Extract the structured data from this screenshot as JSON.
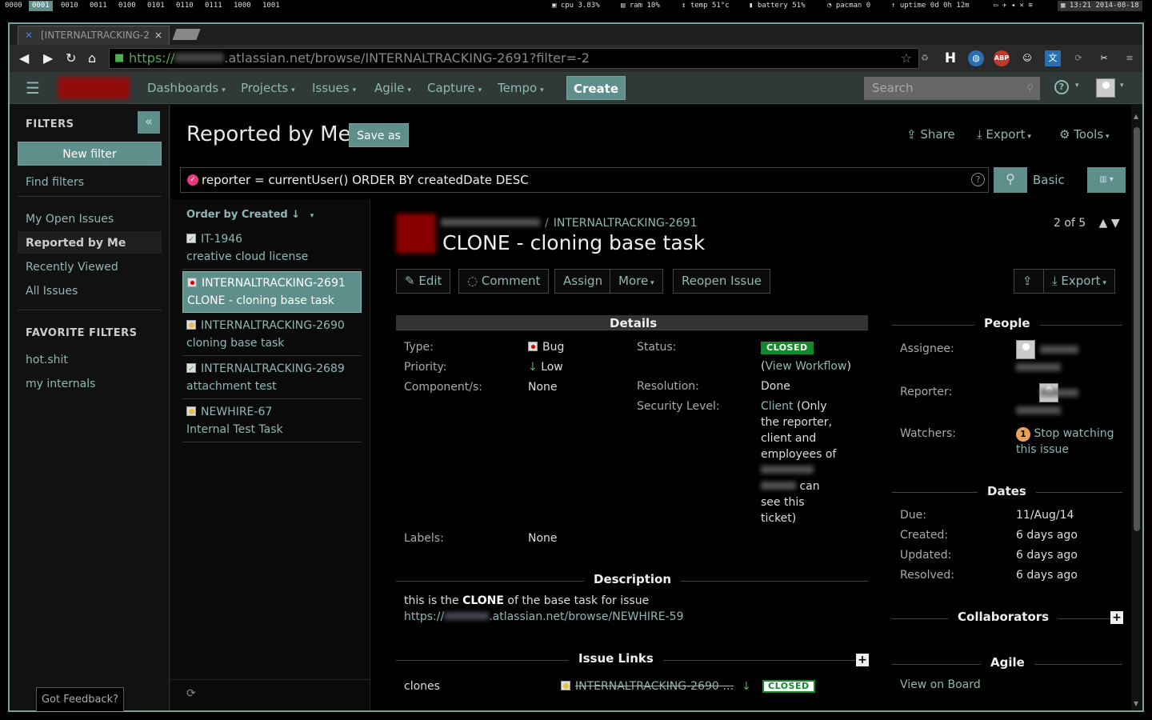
{
  "sysbar": {
    "workspaces": [
      "0000",
      "0001",
      "0010",
      "0011",
      "0100",
      "0101",
      "0110",
      "0111",
      "1000",
      "1001"
    ],
    "active_workspace": "0001",
    "stats": [
      {
        "icon": "cpu-icon",
        "text": "cpu 3.83%"
      },
      {
        "icon": "ram-icon",
        "text": "ram 10%"
      },
      {
        "icon": "thermometer-icon",
        "text": "temp 51°c"
      },
      {
        "icon": "battery-icon",
        "text": "battery 51%"
      },
      {
        "icon": "pacman-icon",
        "text": "pacman 0"
      },
      {
        "icon": "uptime-icon",
        "text": "uptime 0d 0h 12m"
      },
      {
        "icon": "clock-icon",
        "text": "13:21 2014-08-18"
      }
    ]
  },
  "browser": {
    "tab_title": "[INTERNALTRACKING-2",
    "tab_close": "×",
    "url_scheme": "https://",
    "url_rest": ".atlassian.net/browse/INTERNALTRACKING-2691?filter=-2"
  },
  "header": {
    "nav": [
      "Dashboards",
      "Projects",
      "Issues",
      "Agile",
      "Capture",
      "Tempo"
    ],
    "create_label": "Create",
    "search_placeholder": "Search",
    "help": "?"
  },
  "sidebar": {
    "heading": "FILTERS",
    "collapse": "«",
    "new_filter": "New filter",
    "find_filters": "Find filters",
    "items": [
      "My Open Issues",
      "Reported by Me",
      "Recently Viewed",
      "All Issues"
    ],
    "favorites_heading": "FAVORITE FILTERS",
    "favorites": [
      "hot.shit",
      "my internals"
    ],
    "feedback": "Got Feedback?"
  },
  "main": {
    "title": "Reported by Me",
    "save_as": "Save as",
    "share": "Share",
    "export": "Export",
    "tools": "Tools",
    "jql": "reporter = currentUser() ORDER BY createdDate DESC",
    "basic": "Basic",
    "order_by": "Order by Created"
  },
  "issues": [
    {
      "key": "IT-1946",
      "summary": "creative cloud license",
      "type": "task",
      "selected": false
    },
    {
      "key": "INTERNALTRACKING-2691",
      "summary": "CLONE - cloning base task",
      "type": "bug",
      "selected": true
    },
    {
      "key": "INTERNALTRACKING-2690",
      "summary": "cloning base task",
      "type": "improvement",
      "selected": false
    },
    {
      "key": "INTERNALTRACKING-2689",
      "summary": "attachment test",
      "type": "task",
      "selected": false
    },
    {
      "key": "NEWHIRE-67",
      "summary": "Internal Test Task",
      "type": "improvement",
      "selected": false
    }
  ],
  "issue": {
    "breadcrumb_sep": "/",
    "key": "INTERNALTRACKING-2691",
    "title": "CLONE - cloning base task",
    "position": "2 of 5",
    "ops": {
      "edit": "Edit",
      "comment": "Comment",
      "assign": "Assign",
      "more": "More",
      "reopen": "Reopen Issue",
      "export": "Export"
    },
    "details_heading": "Details",
    "type_label": "Type:",
    "type_value": "Bug",
    "priority_label": "Priority:",
    "priority_value": "Low",
    "component_label": "Component/s:",
    "component_value": "None",
    "labels_label": "Labels:",
    "labels_value": "None",
    "status_label": "Status:",
    "status_value": "CLOSED",
    "view_workflow_open": "(",
    "view_workflow": "View Workflow",
    "view_workflow_close": ")",
    "resolution_label": "Resolution:",
    "resolution_value": "Done",
    "security_label": "Security Level:",
    "security_link": "Client",
    "security_text_1": " (Only",
    "security_lines": [
      "the reporter,",
      "client and",
      "employees of"
    ],
    "security_text_can": " can",
    "security_tail": [
      "see this",
      "ticket)"
    ],
    "description_heading": "Description",
    "desc_pre": "this is the ",
    "desc_bold": "CLONE",
    "desc_post": " of the base task for issue",
    "desc_link_a": "https://",
    "desc_link_b": ".atlassian.net/browse/NEWHIRE-59",
    "links_heading": "Issue Links",
    "link_type": "clones",
    "link_key": "INTERNALTRACKING-2690 …",
    "link_status": "CLOSED",
    "people_heading": "People",
    "assignee_label": "Assignee:",
    "reporter_label": "Reporter:",
    "watchers_label": "Watchers:",
    "watch_count": "1",
    "stop_watching_1": "Stop watching",
    "stop_watching_2": "this issue",
    "dates_heading": "Dates",
    "due_label": "Due:",
    "due_value": "11/Aug/14",
    "created_label": "Created:",
    "created_value": "6 days ago",
    "updated_label": "Updated:",
    "updated_value": "6 days ago",
    "resolved_label": "Resolved:",
    "resolved_value": "6 days ago",
    "collab_heading": "Collaborators",
    "agile_heading": "Agile",
    "view_on_board": "View on Board"
  },
  "colors": {
    "accent": "#5f8f8a",
    "link": "#8fb8b2",
    "closed": "#14892c",
    "bug": "#cc0000"
  }
}
